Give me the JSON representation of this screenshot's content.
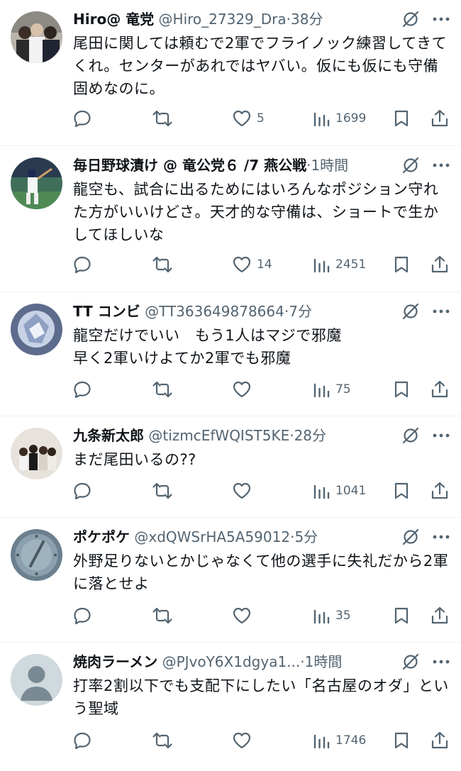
{
  "colors": {
    "text": "#0f1419",
    "muted": "#536471",
    "divider": "#eff3f4"
  },
  "icons": [
    "grok-icon",
    "more-icon",
    "reply-icon",
    "retweet-icon",
    "like-icon",
    "views-icon",
    "bookmark-icon",
    "share-icon"
  ],
  "tweets": [
    {
      "name": "Hiro@ 竜党",
      "handle": "@Hiro_27329_Dra",
      "sep": "·",
      "time": "38分",
      "text": "尾田に関しては頼むで2軍でフライノック練習してきてくれ。センターがあれではヤバい。仮にも仮にも守備固めなのに。",
      "likes": "5",
      "views": "1699"
    },
    {
      "name": "毎日野球漬け @ 竜公党６ /7 燕公戦",
      "handle": "",
      "sep": "·",
      "time": "1時間",
      "text": "龍空も、試合に出るためにはいろんなポジション守れた方がいいけどさ。天才的な守備は、ショートで生かしてほしいな",
      "likes": "14",
      "views": "2451"
    },
    {
      "name": "TT コンビ",
      "handle": "@TT363649878664",
      "sep": "·",
      "time": "7分",
      "text": "龍空だけでいい　もう1人はマジで邪魔\n早く2軍いけよてか2軍でも邪魔",
      "likes": "",
      "views": "75"
    },
    {
      "name": "九条新太郎",
      "handle": "@tizmcEfWQIST5KE",
      "sep": "·",
      "time": "28分",
      "text": "まだ尾田いるの??",
      "likes": "",
      "views": "1041"
    },
    {
      "name": "ポケポケ",
      "handle": "@xdQWSrHA5A59012",
      "sep": "·",
      "time": "5分",
      "text": "外野足りないとかじゃなくて他の選手に失礼だから2軍に落とせよ",
      "likes": "",
      "views": "35"
    },
    {
      "name": "焼肉ラーメン",
      "handle": "@PJvoY6X1dgya1...",
      "sep": "·",
      "time": "1時間",
      "text": "打率2割以下でも支配下にしたい「名古屋のオダ」という聖域",
      "likes": "",
      "views": "1746"
    }
  ]
}
